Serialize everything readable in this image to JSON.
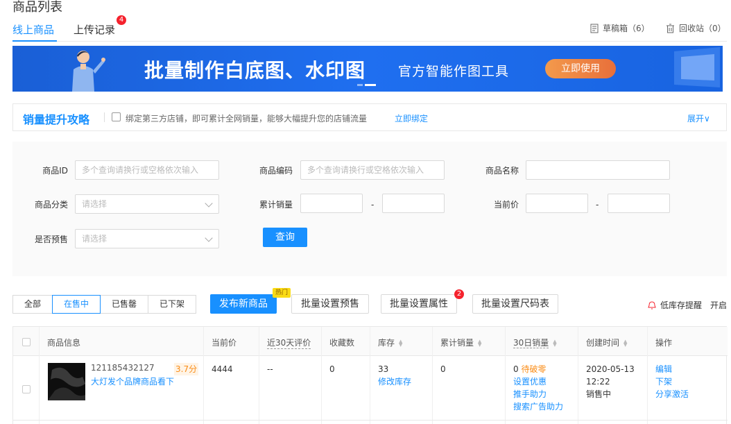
{
  "page": {
    "title": "商品列表"
  },
  "tabs": [
    {
      "label": "线上商品",
      "active": true
    },
    {
      "label": "上传记录",
      "badge": "4"
    }
  ],
  "top_links": {
    "drafts": "草稿箱（6）",
    "recycle": "回收站（0）"
  },
  "banner": {
    "title": "批量制作白底图、水印图",
    "subtitle": "官方智能作图工具",
    "button": "立即使用"
  },
  "strategy": {
    "title": "销量提升攻略",
    "desc": "绑定第三方店铺，即可累计全网销量，能够大幅提升您的店铺流量",
    "bind_link": "立即绑定",
    "expand": "展开∨"
  },
  "filters": {
    "product_id": {
      "label": "商品ID",
      "placeholder": "多个查询请换行或空格依次输入"
    },
    "product_code": {
      "label": "商品编码",
      "placeholder": "多个查询请换行或空格依次输入"
    },
    "product_name": {
      "label": "商品名称",
      "placeholder": ""
    },
    "category": {
      "label": "商品分类",
      "placeholder": "请选择"
    },
    "total_sales": {
      "label": "累计销量",
      "dash": "-"
    },
    "current_price": {
      "label": "当前价",
      "dash": "-"
    },
    "presale": {
      "label": "是否预售",
      "placeholder": "请选择"
    },
    "query_button": "查询"
  },
  "status_tabs": [
    {
      "label": "全部"
    },
    {
      "label": "在售中",
      "active": true
    },
    {
      "label": "已售罄"
    },
    {
      "label": "已下架"
    }
  ],
  "actions": {
    "publish": "发布新商品",
    "hot_tag": "热门",
    "batch_presale": "批量设置预售",
    "batch_attr": "批量设置属性",
    "batch_attr_badge": "2",
    "batch_size": "批量设置尺码表",
    "low_stock": "低库存提醒",
    "low_stock_toggle": "开启"
  },
  "table": {
    "headers": {
      "info": "商品信息",
      "price": "当前价",
      "rating": "近30天评价",
      "fav": "收藏数",
      "stock": "库存",
      "total_sales": "累计销量",
      "sales30": "30日销量",
      "created": "创建时间",
      "ops": "操作"
    },
    "rows": [
      {
        "id": "121185432127",
        "score": "3.7分",
        "name": "大灯发个品牌商品看下",
        "price": "4444",
        "rating": "--",
        "fav": "0",
        "stock": "33",
        "stock_link": "修改库存",
        "total_sales": "0",
        "sales30": "0",
        "sales30_tag": "待破零",
        "promo_links": [
          "设置优惠",
          "推手助力",
          "搜索广告助力"
        ],
        "created_date": "2020-05-13",
        "created_time": "12:22",
        "status": "销售中",
        "ops": [
          "编辑",
          "下架",
          "分享激活"
        ]
      }
    ]
  },
  "colors": {
    "primary": "#1890ff",
    "badge": "#f5222d",
    "warn": "#fa8c16"
  }
}
